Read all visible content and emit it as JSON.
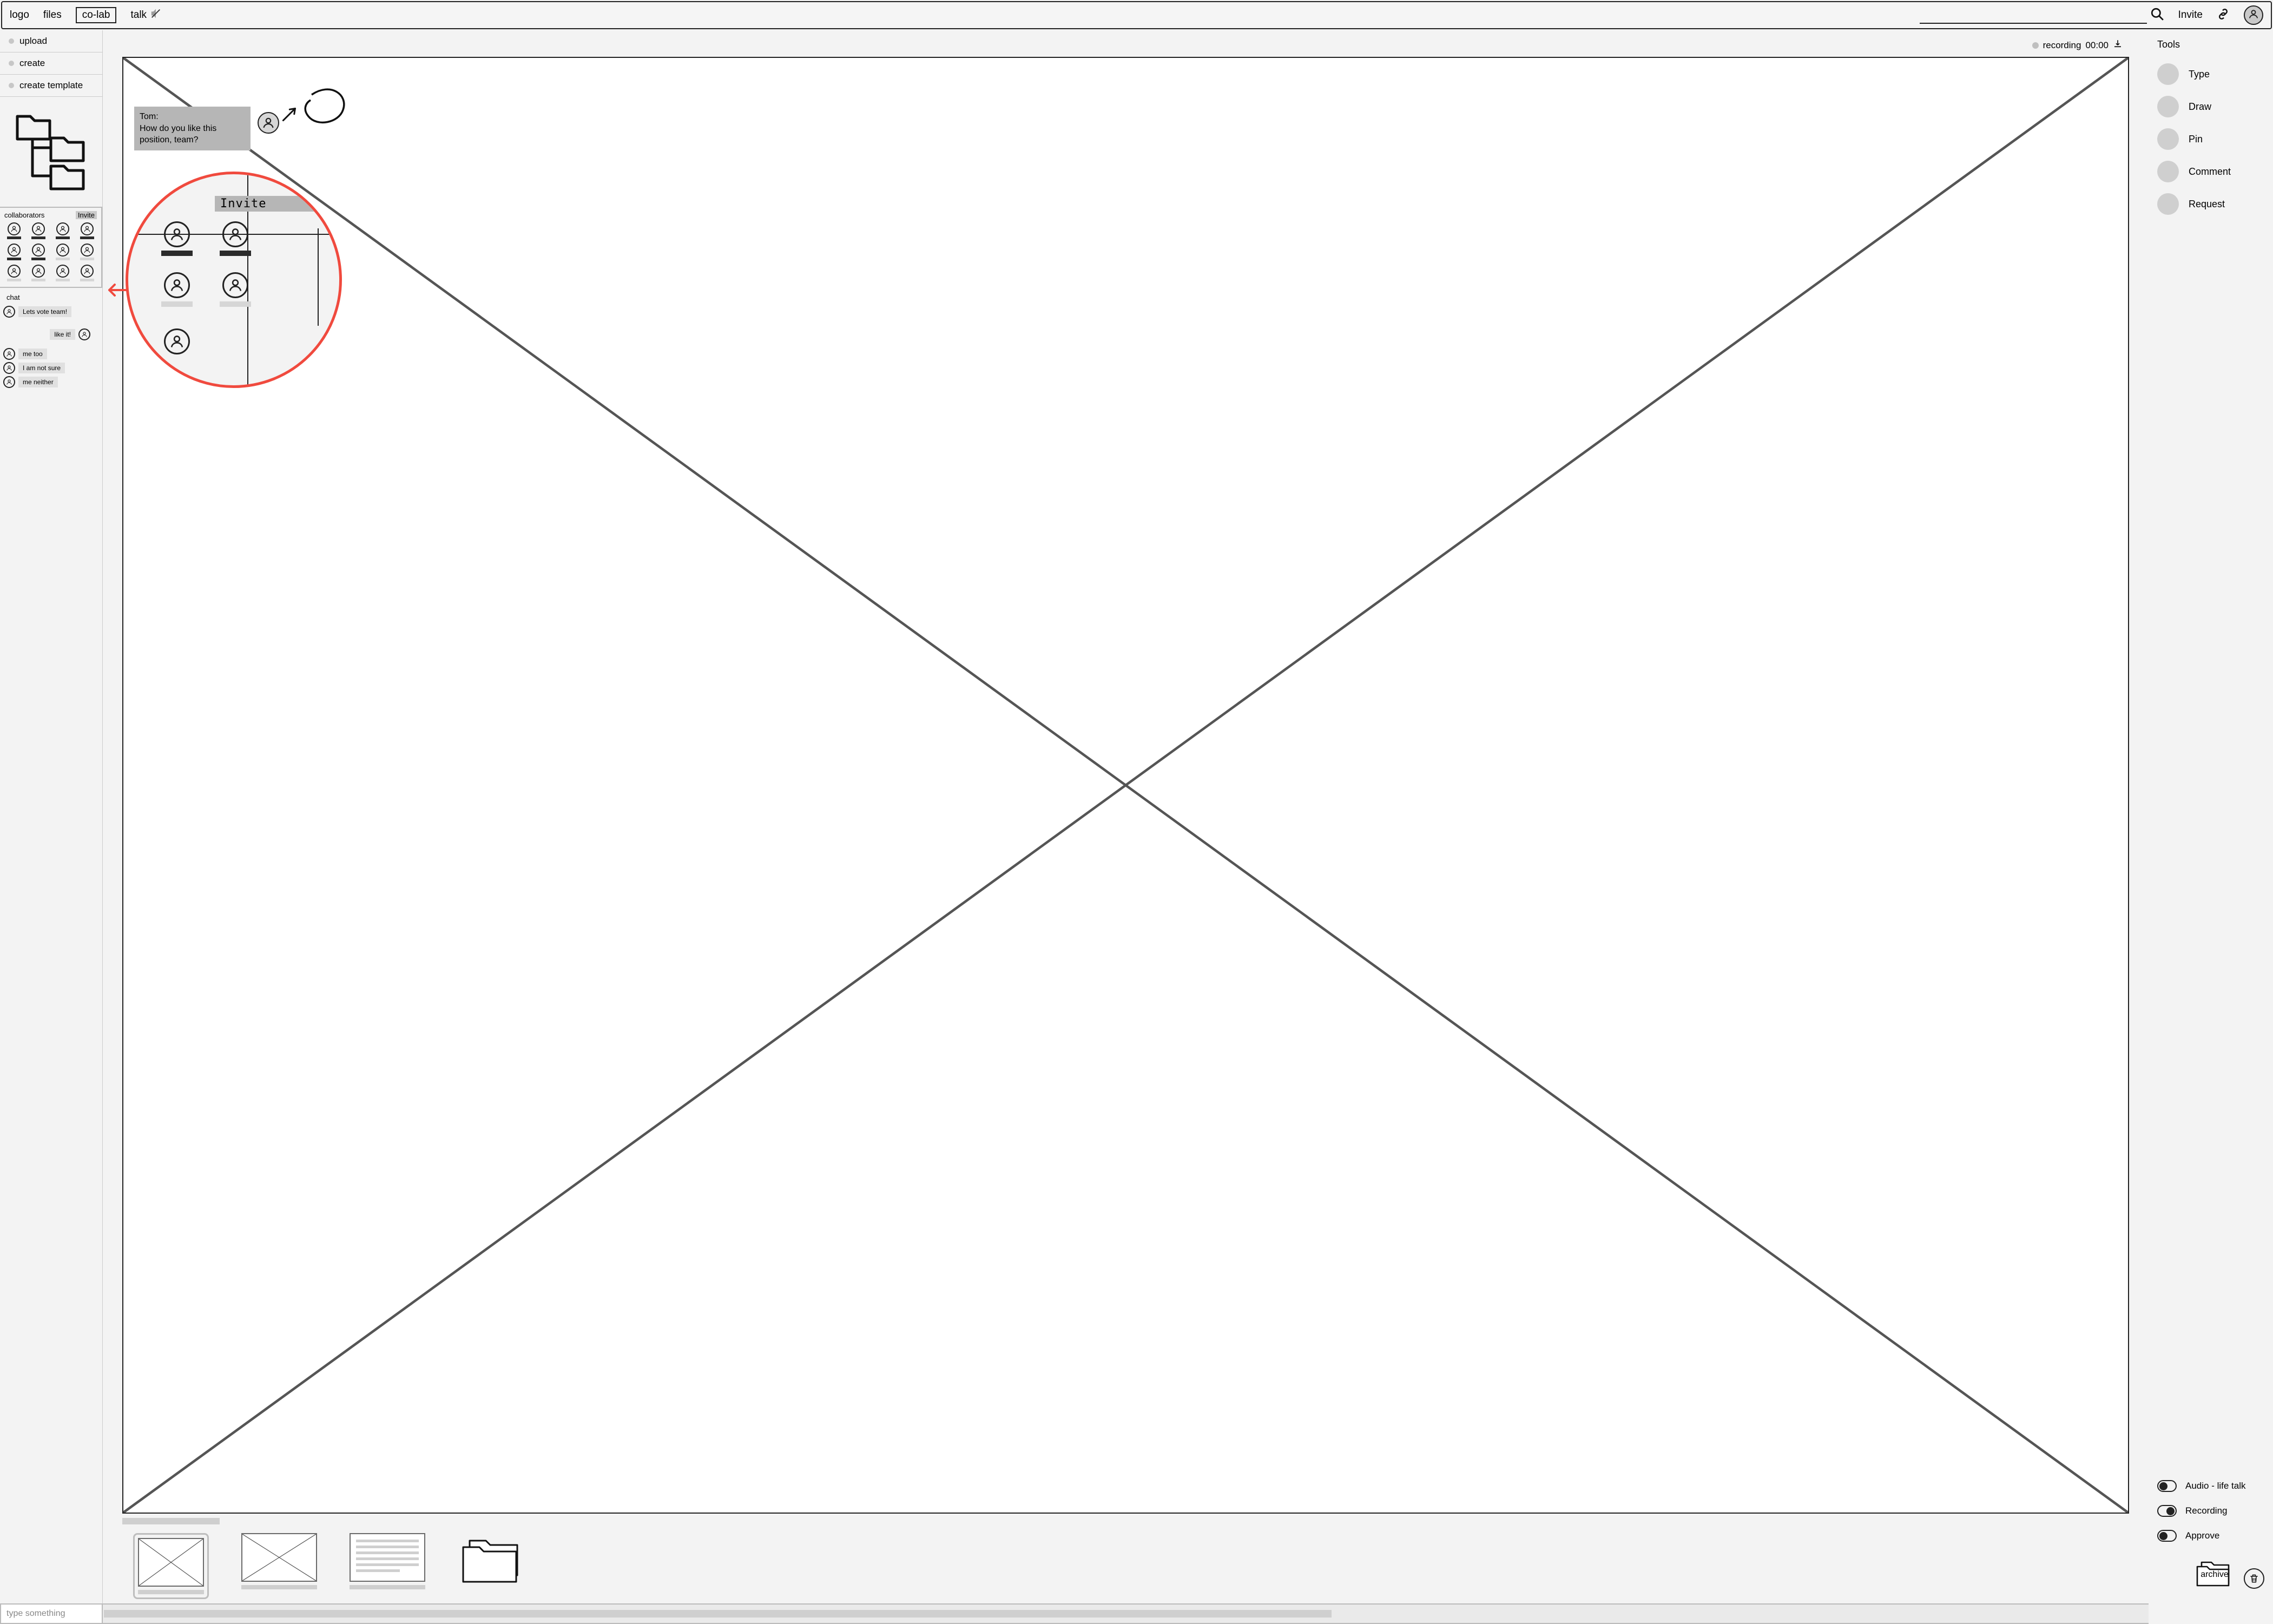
{
  "topnav": {
    "logo": "logo",
    "files": "files",
    "colab": "co-lab",
    "talk": "talk",
    "invite": "Invite"
  },
  "left": {
    "actions": {
      "upload": "upload",
      "create": "create",
      "create_template": "create template"
    },
    "collab_title": "collaborators",
    "collab_invite": "Invite",
    "chat_title": "chat",
    "messages": {
      "m0": "Lets vote team!",
      "m1": "like it!",
      "m2": "me too",
      "m3": "I am not sure",
      "m4": "me neither"
    },
    "input_placeholder": "type something"
  },
  "canvas": {
    "recording_label": "recording",
    "recording_time": "00:00",
    "tom_name": "Tom:",
    "tom_msg": "How do you like this position, team?",
    "mag_invite": "Invite"
  },
  "right": {
    "title": "Tools",
    "tools": {
      "type": "Type",
      "draw": "Draw",
      "pin": "Pin",
      "comment": "Comment",
      "request": "Request"
    },
    "toggles": {
      "audio": "Audio - life talk",
      "recording": "Recording",
      "approve": "Approve"
    },
    "archive": "archive"
  }
}
